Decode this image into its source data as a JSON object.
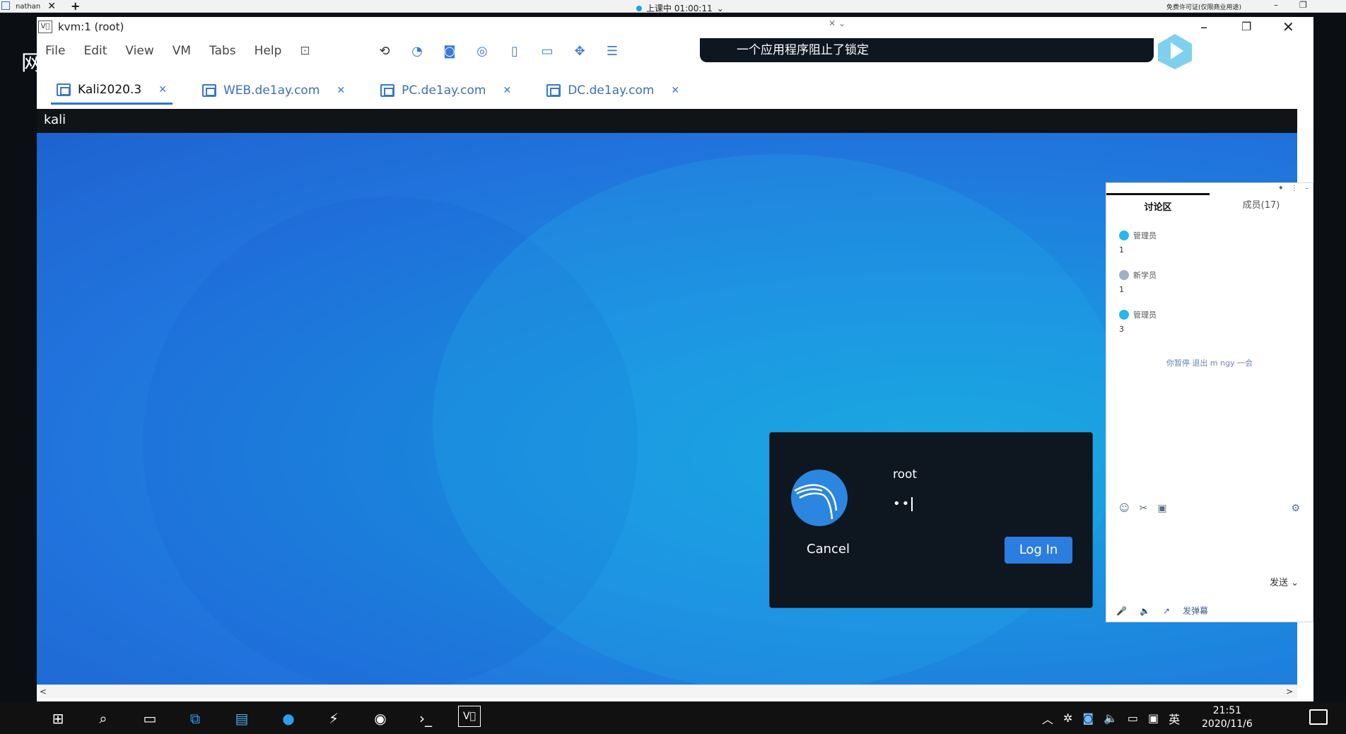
{
  "outer": {
    "tab_label": "nathan",
    "status_text": "上课中 01:00:11",
    "right_text": "免费许可证(仅限商业用途)",
    "collapse_glyph": "ˇ"
  },
  "left_glyph": "网",
  "window": {
    "title": "kvm:1 (root)",
    "menu": [
      "File",
      "Edit",
      "View",
      "VM",
      "Tabs",
      "Help"
    ],
    "lock_banner": "一个应用程序阻止了锁定"
  },
  "tabs": [
    {
      "label": "Kali2020.3",
      "active": true
    },
    {
      "label": "WEB.de1ay.com",
      "active": false
    },
    {
      "label": "PC.de1ay.com",
      "active": false
    },
    {
      "label": "DC.de1ay.com",
      "active": false
    }
  ],
  "kali": {
    "top_label": "kali"
  },
  "login": {
    "username": "root",
    "password_mask": "••",
    "cancel": "Cancel",
    "login": "Log In"
  },
  "chat": {
    "tabs": [
      "讨论区",
      "成员(17)"
    ],
    "messages": [
      {
        "who": "管理员",
        "text": "1"
      },
      {
        "who": "新学员",
        "text": "1"
      },
      {
        "who": "管理员",
        "text": "3"
      }
    ],
    "notice": "你暂停 退出 m ngy 一会",
    "send": "发送",
    "bottom_text": "发弹幕"
  },
  "taskbar": {
    "ime": "英",
    "time": "21:51",
    "date": "2020/11/6"
  },
  "colors": {
    "accent": "#2b7ee0",
    "kali_blue": "#1b8fe0",
    "dialog_bg": "#0e1620"
  }
}
